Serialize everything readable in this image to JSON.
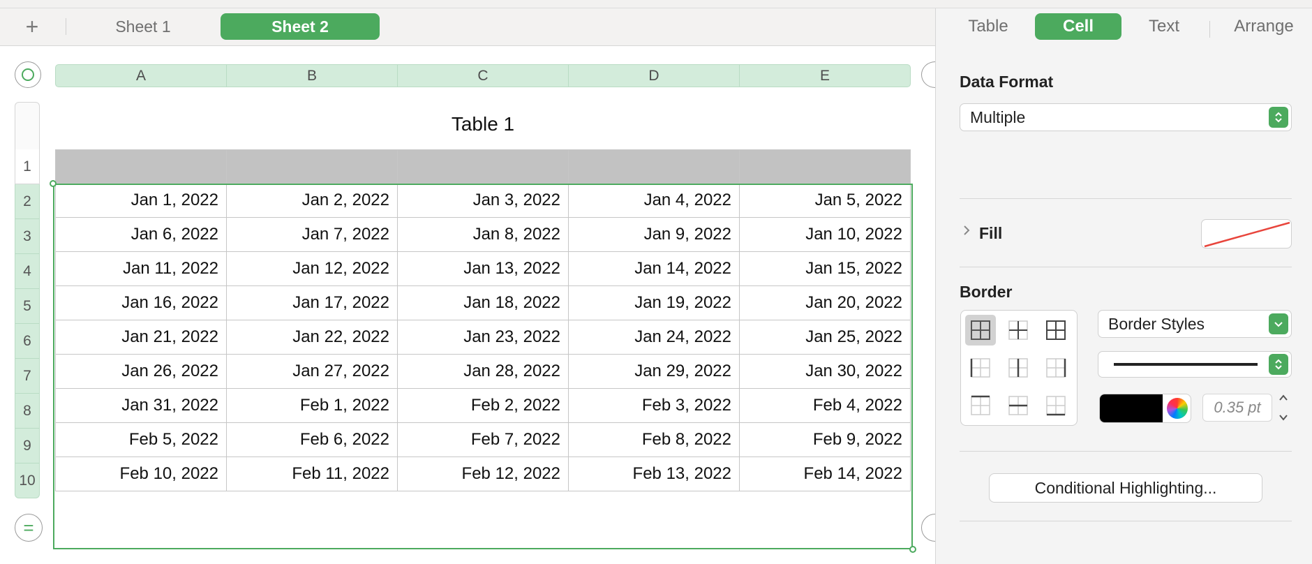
{
  "sheet_tabs": {
    "add_symbol": "+",
    "tabs": [
      {
        "label": "Sheet 1",
        "active": false
      },
      {
        "label": "Sheet 2",
        "active": true
      }
    ]
  },
  "table": {
    "title": "Table 1",
    "column_letters": [
      "A",
      "B",
      "C",
      "D",
      "E"
    ],
    "row_numbers": [
      "1",
      "2",
      "3",
      "4",
      "5",
      "6",
      "7",
      "8",
      "9",
      "10"
    ],
    "header_row": [
      "",
      "",
      "",
      "",
      ""
    ],
    "rows": [
      [
        "Jan 1, 2022",
        "Jan 2, 2022",
        "Jan 3, 2022",
        "Jan 4, 2022",
        "Jan 5, 2022"
      ],
      [
        "Jan 6, 2022",
        "Jan 7, 2022",
        "Jan 8, 2022",
        "Jan 9, 2022",
        "Jan 10, 2022"
      ],
      [
        "Jan 11, 2022",
        "Jan 12, 2022",
        "Jan 13, 2022",
        "Jan 14, 2022",
        "Jan 15, 2022"
      ],
      [
        "Jan 16, 2022",
        "Jan 17, 2022",
        "Jan 18, 2022",
        "Jan 19, 2022",
        "Jan 20, 2022"
      ],
      [
        "Jan 21, 2022",
        "Jan 22, 2022",
        "Jan 23, 2022",
        "Jan 24, 2022",
        "Jan 25, 2022"
      ],
      [
        "Jan 26, 2022",
        "Jan 27, 2022",
        "Jan 28, 2022",
        "Jan 29, 2022",
        "Jan 30, 2022"
      ],
      [
        "Jan 31, 2022",
        "Feb 1, 2022",
        "Feb 2, 2022",
        "Feb 3, 2022",
        "Feb 4, 2022"
      ],
      [
        "Feb 5, 2022",
        "Feb 6, 2022",
        "Feb 7, 2022",
        "Feb 8, 2022",
        "Feb 9, 2022"
      ],
      [
        "Feb 10, 2022",
        "Feb 11, 2022",
        "Feb 12, 2022",
        "Feb 13, 2022",
        "Feb 14, 2022"
      ]
    ],
    "add_row_symbol": "="
  },
  "inspector": {
    "tabs": [
      {
        "label": "Table",
        "active": false
      },
      {
        "label": "Cell",
        "active": true
      },
      {
        "label": "Text",
        "active": false
      },
      {
        "label": "Arrange",
        "active": false
      }
    ],
    "data_format": {
      "label": "Data Format",
      "value": "Multiple"
    },
    "fill": {
      "label": "Fill",
      "swatch": "none"
    },
    "border": {
      "label": "Border",
      "style_popup": "Border Styles",
      "color": "#000000",
      "width_placeholder": "0.35 pt"
    },
    "conditional_button": "Conditional Highlighting..."
  },
  "colors": {
    "accent": "#4caa5e",
    "header_fill": "#c2c2c2",
    "column_header": "#d3ecdb"
  }
}
